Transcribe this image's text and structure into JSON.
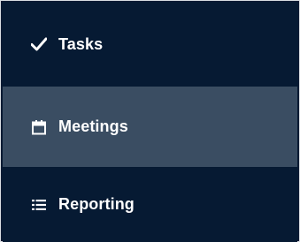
{
  "menu": {
    "items": [
      {
        "label": "Tasks",
        "icon": "check-icon",
        "active": false
      },
      {
        "label": "Meetings",
        "icon": "calendar-icon",
        "active": true
      },
      {
        "label": "Reporting",
        "icon": "list-icon",
        "active": false
      }
    ]
  },
  "colors": {
    "background": "#061a33",
    "active_background": "#3a4d62",
    "text": "#ffffff",
    "border": "#d9dde2"
  }
}
